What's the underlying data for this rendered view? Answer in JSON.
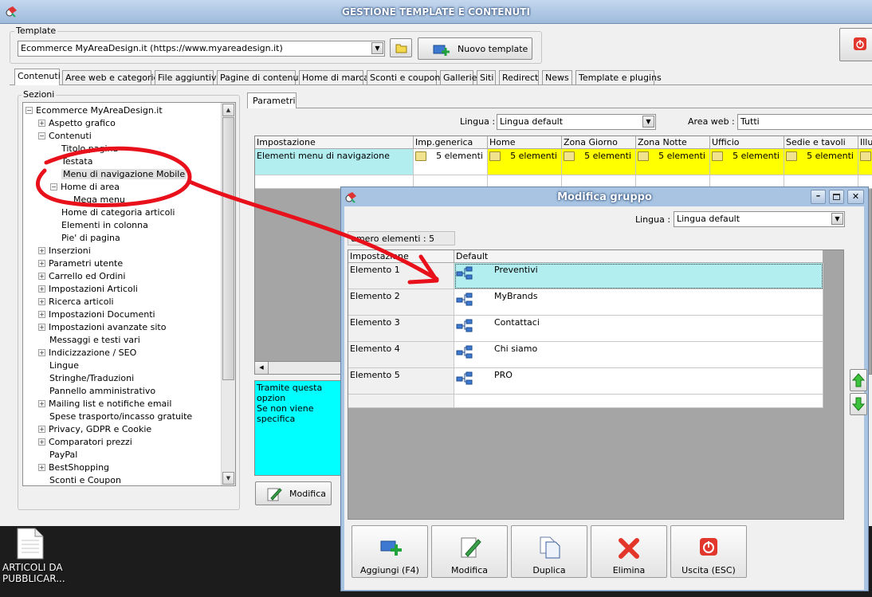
{
  "main_window": {
    "title": "GESTIONE TEMPLATE E CONTENUTI",
    "template_group_label": "Template",
    "template_value": "Ecommerce MyAreaDesign.it (https://www.myareadesign.it)",
    "new_template_label": "Nuovo template"
  },
  "tabs": [
    {
      "label": "Contenuti",
      "active": true
    },
    {
      "label": "Aree web e categorie"
    },
    {
      "label": "File aggiuntivi"
    },
    {
      "label": "Pagine di contenuti"
    },
    {
      "label": "Home di marca"
    },
    {
      "label": "Sconti e coupon"
    },
    {
      "label": "Gallerie"
    },
    {
      "label": "Siti"
    },
    {
      "label": "Redirect"
    },
    {
      "label": "News"
    },
    {
      "label": "Template e plugins"
    }
  ],
  "sections": {
    "label": "Sezioni",
    "tree": [
      {
        "label": "Ecommerce MyAreaDesign.it",
        "level": 0,
        "expander": "-"
      },
      {
        "label": "Aspetto grafico",
        "level": 1,
        "expander": "+"
      },
      {
        "label": "Contenuti",
        "level": 1,
        "expander": "-"
      },
      {
        "label": "Titolo pagina",
        "level": 2,
        "expander": ""
      },
      {
        "label": "Testata",
        "level": 2,
        "expander": ""
      },
      {
        "label": "Menu di navigazione Mobile",
        "level": 2,
        "expander": "",
        "selected": true
      },
      {
        "label": "Home di area",
        "level": 2,
        "expander": "-"
      },
      {
        "label": "Mega menu",
        "level": 3,
        "expander": ""
      },
      {
        "label": "Home di categoria articoli",
        "level": 2,
        "expander": ""
      },
      {
        "label": "Elementi in colonna",
        "level": 2,
        "expander": ""
      },
      {
        "label": "Pie' di pagina",
        "level": 2,
        "expander": ""
      },
      {
        "label": "Inserzioni",
        "level": 1,
        "expander": "+"
      },
      {
        "label": "Parametri utente",
        "level": 1,
        "expander": "+"
      },
      {
        "label": "Carrello ed Ordini",
        "level": 1,
        "expander": "+"
      },
      {
        "label": "Impostazioni Articoli",
        "level": 1,
        "expander": "+"
      },
      {
        "label": "Ricerca articoli",
        "level": 1,
        "expander": "+"
      },
      {
        "label": "Impostazioni Documenti",
        "level": 1,
        "expander": "+"
      },
      {
        "label": "Impostazioni avanzate sito",
        "level": 1,
        "expander": "+"
      },
      {
        "label": "Messaggi e testi vari",
        "level": 1,
        "expander": ""
      },
      {
        "label": "Indicizzazione / SEO",
        "level": 1,
        "expander": "+"
      },
      {
        "label": "Lingue",
        "level": 1,
        "expander": ""
      },
      {
        "label": "Stringhe/Traduzioni",
        "level": 1,
        "expander": ""
      },
      {
        "label": "Pannello amministrativo",
        "level": 1,
        "expander": ""
      },
      {
        "label": "Mailing list e notifiche email",
        "level": 1,
        "expander": "+"
      },
      {
        "label": "Spese trasporto/incasso gratuite",
        "level": 1,
        "expander": ""
      },
      {
        "label": "Privacy, GDPR e Cookie",
        "level": 1,
        "expander": "+"
      },
      {
        "label": "Comparatori prezzi",
        "level": 1,
        "expander": "+"
      },
      {
        "label": "PayPal",
        "level": 1,
        "expander": ""
      },
      {
        "label": "BestShopping",
        "level": 1,
        "expander": "+"
      },
      {
        "label": "Sconti e Coupon",
        "level": 1,
        "expander": ""
      }
    ]
  },
  "params": {
    "tab_label": "Parametri",
    "lingua_label": "Lingua :",
    "lingua_value": "Lingua default",
    "area_label": "Area web :",
    "area_value": "Tutti",
    "columns": [
      "Impostazione",
      "Imp.generica",
      "Home",
      "Zona Giorno",
      "Zona Notte",
      "Ufficio",
      "Sedie e tavoli",
      "Illu"
    ],
    "row": {
      "setting": "Elementi menu di navigazione",
      "values": [
        "5 elementi",
        "5 elementi",
        "5 elementi",
        "5 elementi",
        "5 elementi",
        "5 elementi",
        ""
      ]
    },
    "description_lines": [
      "Tramite questa opzion",
      "Se non viene specifica"
    ],
    "modify_label": "Modifica"
  },
  "dialog": {
    "title": "Modifica gruppo",
    "lingua_label": "Lingua :",
    "lingua_value": "Lingua default",
    "count_label": "umero elementi : 5",
    "col_setting": "Impostazione",
    "col_default": "Default",
    "rows": [
      {
        "name": "Elemento 1",
        "value": "Preventivi"
      },
      {
        "name": "Elemento 2",
        "value": "MyBrands"
      },
      {
        "name": "Elemento 3",
        "value": "Contattaci"
      },
      {
        "name": "Elemento 4",
        "value": "Chi siamo"
      },
      {
        "name": "Elemento 5",
        "value": "PRO"
      }
    ],
    "buttons": {
      "add": "Aggiungi (F4)",
      "modify": "Modifica",
      "duplicate": "Duplica",
      "delete": "Elimina",
      "exit": "Uscita (ESC)"
    }
  },
  "desktop": {
    "icon_label_1": "ARTICOLI DA",
    "icon_label_2": "PUBBLICAR..."
  },
  "colors": {
    "selected_row": "#b2eef0",
    "yellow_cell": "#ffff00",
    "description_bg": "#00ffff",
    "annotation": "#e8101a",
    "dialog_title": "#a8c4e2"
  }
}
